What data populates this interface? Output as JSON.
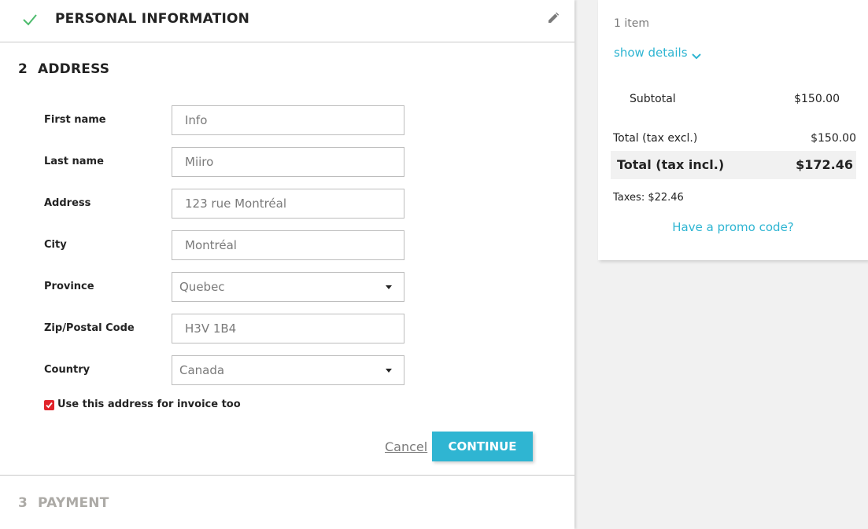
{
  "steps": {
    "personal": {
      "title": "Personal Information"
    },
    "address": {
      "number": "2",
      "title": "Address"
    },
    "payment": {
      "number": "3",
      "title": "Payment"
    }
  },
  "address_form": {
    "fields": [
      {
        "label": "First name",
        "value": "Info"
      },
      {
        "label": "Last name",
        "value": "Miiro"
      },
      {
        "label": "Address",
        "value": "123 rue Montréal"
      },
      {
        "label": "City",
        "value": "Montréal"
      },
      {
        "label": "Province",
        "value": "Quebec"
      },
      {
        "label": "Zip/Postal Code",
        "value": "H3V 1B4"
      },
      {
        "label": "Country",
        "value": "Canada"
      }
    ],
    "invoice_checkbox_label": "Use this address for invoice too",
    "invoice_checked": true,
    "cancel_label": "Cancel",
    "continue_label": "Continue"
  },
  "summary": {
    "items_count": "1 item",
    "show_details": "show details",
    "subtotal_label": "Subtotal",
    "subtotal_value": "$150.00",
    "total_excl_label": "Total (tax excl.)",
    "total_excl_value": "$150.00",
    "total_incl_label": "Total (tax incl.)",
    "total_incl_value": "$172.46",
    "taxes": "Taxes: $22.46",
    "promo": "Have a promo code?"
  },
  "colors": {
    "accent": "#2fb5d2",
    "success": "#4cbb6c",
    "checkbox": "#e1232a"
  }
}
